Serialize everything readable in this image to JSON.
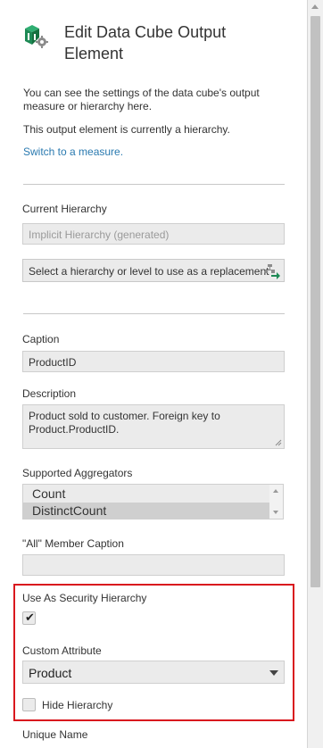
{
  "header": {
    "title": "Edit Data Cube Output Element"
  },
  "intro": {
    "line1": "You can see the settings of the data cube's output measure or hierarchy here.",
    "line2": "This output element is currently a hierarchy.",
    "switch_link": "Switch to a measure."
  },
  "current_hierarchy": {
    "label": "Current Hierarchy",
    "value": "Implicit Hierarchy (generated)",
    "replace_button": "Select a hierarchy or level to use as a replacement"
  },
  "caption": {
    "label": "Caption",
    "value": "ProductID"
  },
  "description": {
    "label": "Description",
    "value": "Product sold to customer. Foreign key to Product.ProductID."
  },
  "aggregators": {
    "label": "Supported Aggregators",
    "items": [
      "Count",
      "DistinctCount"
    ],
    "selected": "DistinctCount"
  },
  "all_member_caption": {
    "label": "\"All\" Member Caption",
    "value": ""
  },
  "security": {
    "label": "Use As Security Hierarchy",
    "checked": true,
    "check_glyph": "✔"
  },
  "custom_attribute": {
    "label": "Custom Attribute",
    "value": "Product"
  },
  "hide_hierarchy": {
    "label": "Hide Hierarchy",
    "checked": false
  },
  "unique_name": {
    "label": "Unique Name"
  },
  "colors": {
    "highlight": "#d9181e",
    "link": "#2a7ab0",
    "icon_green": "#1e8a55"
  }
}
